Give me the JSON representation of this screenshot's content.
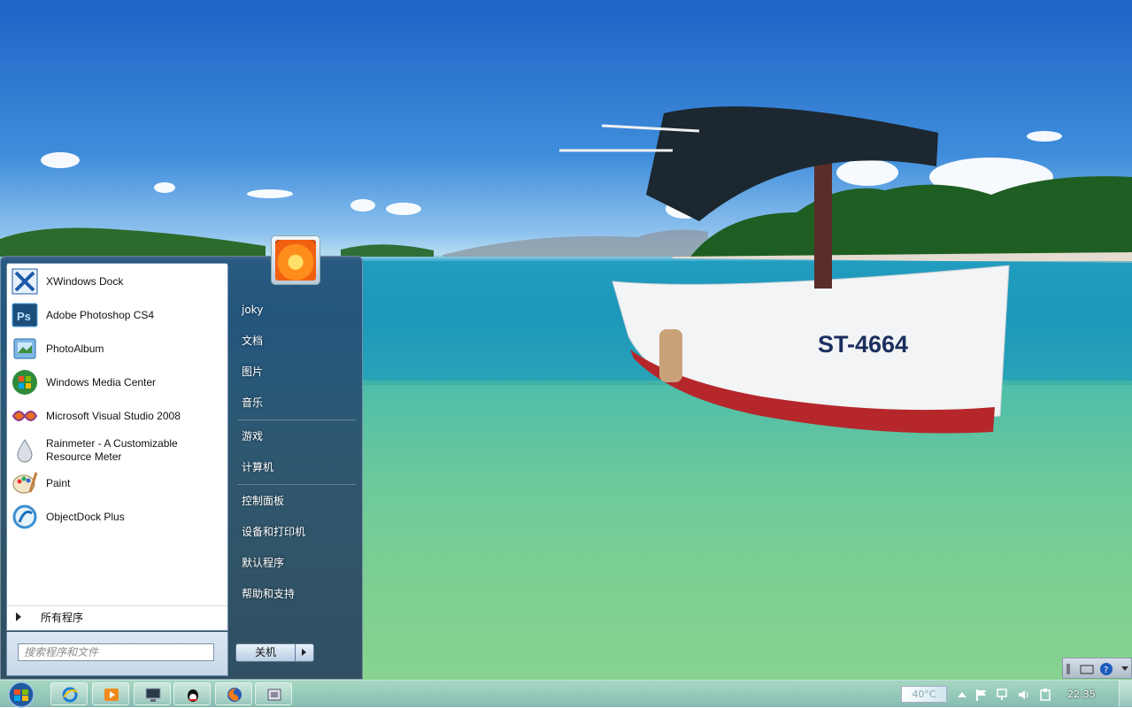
{
  "start_menu": {
    "programs": [
      {
        "label": "XWindows Dock",
        "icon": "xwindows-dock-icon"
      },
      {
        "label": "Adobe Photoshop CS4",
        "icon": "photoshop-icon"
      },
      {
        "label": "PhotoAlbum",
        "icon": "photoalbum-icon"
      },
      {
        "label": "Windows Media Center",
        "icon": "media-center-icon"
      },
      {
        "label": "Microsoft Visual Studio 2008",
        "icon": "visual-studio-icon"
      },
      {
        "label": "Rainmeter - A Customizable Resource Meter",
        "icon": "rainmeter-icon"
      },
      {
        "label": "Paint",
        "icon": "paint-icon"
      },
      {
        "label": "ObjectDock Plus",
        "icon": "objectdock-icon"
      }
    ],
    "all_programs": "所有程序",
    "search_placeholder": "搜索程序和文件",
    "right_items": {
      "user": "joky",
      "documents": "文档",
      "pictures": "图片",
      "music": "音乐",
      "games": "游戏",
      "computer": "计算机",
      "control_panel": "控制面板",
      "devices": "设备和打印机",
      "default_programs": "默认程序",
      "help": "帮助和支持"
    },
    "shutdown": "关机"
  },
  "taskbar": {
    "temperature": "40°C",
    "clock": "22:35"
  },
  "wallpaper": {
    "boat_text": "ST-4664"
  },
  "colors": {
    "sky": "#2f7fd4",
    "water": "#3ab7b0",
    "boat_hull": "#f4f6f7",
    "boat_stripe": "#b5272b"
  }
}
